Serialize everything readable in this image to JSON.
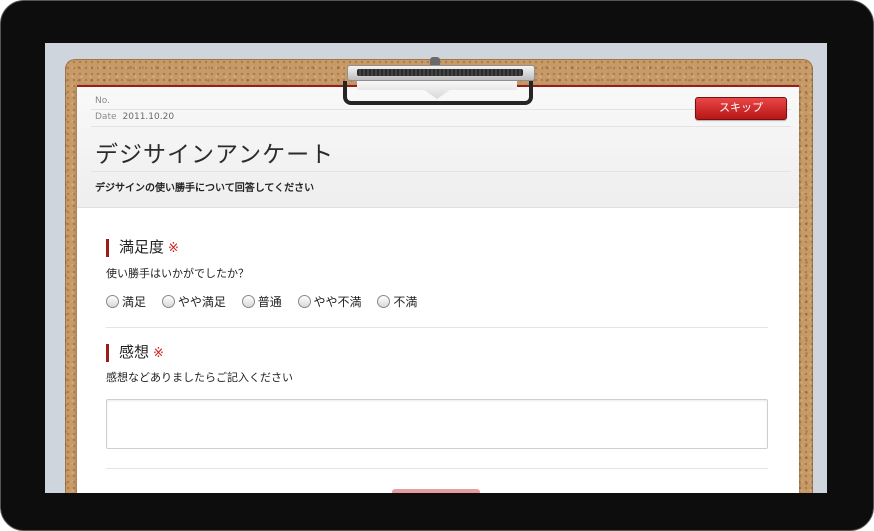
{
  "header": {
    "no_label": "No.",
    "date_label": "Date",
    "date_value": "2011.10.20",
    "skip_label": "スキップ",
    "title": "デジサインアンケート",
    "subtitle": "デジサインの使い勝手について回答してください"
  },
  "questions": [
    {
      "heading": "満足度",
      "required_mark": "※",
      "text": "使い勝手はいかがでしたか？",
      "options": [
        "満足",
        "やや満足",
        "普通",
        "やや不満",
        "不満"
      ]
    },
    {
      "heading": "感想",
      "required_mark": "※",
      "text": "感想などありましたらご記入ください",
      "answer": ""
    }
  ],
  "colors": {
    "accent": "#9c1b1b",
    "skip_button": "#c41a1a",
    "cork": "#c79a67",
    "device_frame": "#0d0d0d"
  },
  "icons": {
    "radio": "radio-button-icon",
    "clip": "clipboard-clip-icon"
  }
}
